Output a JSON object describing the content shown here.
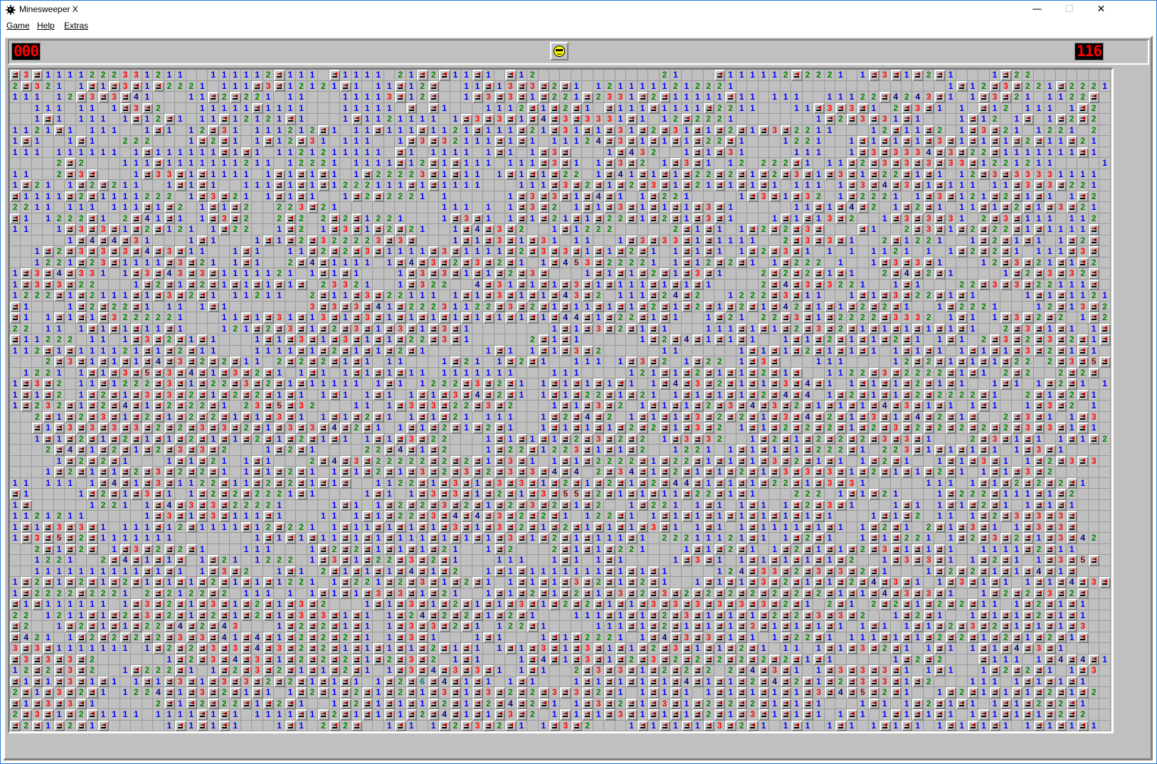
{
  "window": {
    "title": "Minesweeper X",
    "app_icon": "mine-icon",
    "controls": {
      "minimize": "—",
      "maximize": "☐",
      "close": "✕"
    }
  },
  "menubar": {
    "items": [
      "Game",
      "Help",
      "Extras"
    ]
  },
  "status": {
    "mines_remaining": "000",
    "timer": "116",
    "face": "sunglasses-smiley-icon"
  },
  "board": {
    "columns": 100,
    "rows": 60,
    "legend": "c = open empty, 1-8 = number, f = flagged mine",
    "cells": [
      "f3f1111222331211..111112f111.f1111.21f2f11f1.f12...........21...f111112f2221.1f3f1f2f1...1f22......",
      "2f321.1f1f3f1f2221.111f3f12121f1.11f12f..11f13f3f2f1.1211111212221...................1f12f3f221f2221",
      "111.12f3f3f41...11f2f221.11...11113f12f..1f3f3f1f221f2331f2f11111f11.111..11122f4243f1.1f3f21.1122f",
      "..111.11.1f3f2...11111f1111...11111.f.f1...1112f1f2f1.f111f1111f2211...11f3f3f1.2f3f1.1.f12.111.1f2",
      "..1f1.111.1f12f1.11f12121f1...1f1121111.1f3f3f1f4f3f3331f1.12f2221.......1f2f3f31f1...1f12.1f.1f2f2",
      "1121f1.111..1f1.12f31.111212f1.11f111f1121f111f21f31f1f31f2f31f1f2f1f3f2211...12f11f2.1f3f21.1221.2",
      "1f1..1f1..222...1f2f1.1f12f31.111..1f3f32111f1f1.11124f3f1f1f1f22f1...1221..1f1f1f1f3f1f1f1f2f11f21",
      "111.111111.1f111111f1f1.1121211111.f1.1111.1f1.1f3f...1f432..1f1f31....111..1f3f3334f3f22f1111111f1",
      "....2f2...111f1111111211.12221.1111f12f1f111.111f3f1.1f3f2.1f3f1.12.222f1.11f2f3f3f3f33f1221211....1",
      "11..2f3f...1f33f1f1111.1f1f1f1.1f22223f1f11.1f1f1f22.1f41f1f1f22f2f1f2f3f1f3f1f22f1f1.12f3f33331111",
      "1f21.1f2f211..1f1f1..111f1f1f1222111f1f1111...111f3f2f1f2f3f1f21f1f1f1.111.1f3f4f3f1f111.11f3f3f221",
      "f1111f2f1111222.1f3f21.1f1f1..1f2f2221.1.....1f3f3f1f4f1.1f221....1f3f1f32.1f2221.1f3f121f2f1f1.1f2",
      "2211.111.111f1f2.1f1f2..223f21.........111.1.1f3f2.1f1f3f1f1f1f3f1.....11f1f4f2.1f2f1.11f1f2f1f3f21",
      "f1.1222f1.2f41f1.1f3f2..2f2.2f2f1221...1f3f1.1f1f21f1f22f1f2f1f3f1...1f1f13f2..1f3f3f31.2f3f111.112",
      "11..1f3f3f1f2f121.1f22..1f2.1f3f1f2f21..1f4f3f2..1f1222.....2f1f1.1f2f2f3f...f1..2f3f1f2f22f1f1111f",
      ".....1f4f4f31...1f1...1f1f2f322223f3f...1f1f3f1f31.11..1f3f33f1f1111..2f3f3f1..2f1221..1f2f1f1.1f2f",
      "..1f2f3f3f3f4f3f11..1f1..11f2f2f3f1111f3f1111f2f3f3f1f1f2f1.1f1f1.1f2f3f1.1.1.1121.1.1f2f2f1.111f3f",
      "..1221f23f1111f3f21.1f1..2f4f1111.1f4f3f2f3f2f1.1f453f22221.1f12f2f1.1f222.1..1f3f3f1...12f3f21f1f2",
      "1f3f4f331.1f3f43f3f1111121.1f1f1...1f3f3f1f1f2f3f...1f1f1f2f1f3f1...2f2f2f1f1..2f4f2f1....1f2f3f32f",
      "1f3f3f22...1f2f1f2f1f1f1f1f.23321..1f322..4f31f1f1f3f1f111f1f1f1....2f4f3f3221..1f1...22f3f3f22111f",
      "1222f1f2111f1f3f2f1.11211..2f11f3f22111.1f1f3f1f1f43f2.111f24f2..1222f3f11..1f1f3f22f1f1....1f1f1121",
      "f1...1f2f22f1.11.1f1.......3f3f3f41f22231122f3f2f1f11f1f1f2f1f2f1f2f1f42f1f1f2f2f1..1f2221...12f13f2",
      "f1.1f1f1f3222221...11f1f31f13f1f3f1f1f1f1f1f1f1f1f44f1f22f1f1..1f21.22f3f1f2222f3332.1f1.1f3f2f2.1f2",
      "22.11.1f1f1f11f1...121f2f3f1f2f3f1f3f1f3f1.......1f1f3f2f1f1...111f1f1f2f3f2f1f1f1f1f1f1..2f3f1f1.1f",
      "f11222.11.1f3f2f1f1...1f1f3f1f3f1f1f22f3f1.....2f1f1.....1f2f4f1f1f1..1f1f2f1f1f2f1.1f1.2f3f2f3f2f1f",
      "112f1f111121f1f2f11...1111f1f2f1f1f2f1.....1f1.1f1f3f2.....11.....1f1f1f2f1f1f1.1f1f1.1f1f1f3f2f1f1.",
      "...2f3f1f1f1f4f3f2f2f11.2f2f2f1f1.11...1f21.1f2f1..111.1f3f2.1f22.1f3f...111....12f2f1f1f1f22.2f3f5f3",
      ".1221.1f1f3f5f3f4f1f3f2f1.1f1.1f1f1f11.1111111...111....121f1f2f1f1f2f1f..1122f3f2222f1f1.2f2..2f2f",
      "1f3f2.11f1222f3f1f22f3f2f1f11111.1f1.1222f3f2f1.1f1f1f1f1.1f4f3f2f1f1f3f4f1.1f1f1f2f1f1..1f1.1f2f1.1",
      "1f1f2.1f2f1f3f3f2f1f2f2f1f1.1f1.1f1.1f1f3f4f2f1.1f1f22f1f21.1f1f1f1f2f4f4.1f2f1f1f2f2222f1..2f1f2f1",
      "1f232f1f2f4f1f2f22f1.23f5f32...11.1f3f3f22f3f2...1f1f3f2.1f1f1f2f3f4f3f2f1f1f1f4f3f1f1.1f1..1f3f2.1",
      "..2f1f2f3f1f2f1f2f2f1f1f3f1.1f1f2f1.1f1f21.111..1f2f4f2.1f1f1f3f2f2f1f3f4f2f1f3f1f4f2f1f..2f3f1.1f3",
      "..f1f3f3f3f3f2f2f3f3f2f1f3f3f4f2f1.1f1f2f1f2f1..1f1f1f1f2f2f1f3f2.1f1f2f2f2f1f2f3f2f2f2f2f2f3f3f1f1",
      "..1f1f2f1f2f1f1f2f1f1f2f1f2f1f1.1f1f3f22...1f1f1f1f2f3f2f2.1f3f32..1f2f1f2f2f2f3f3f1...2f3f1f1.1f1f2",
      "...2f4f1f2f1f2f3f3f2...1f2f1....22f4f1f2...1f22f1223f1f1f2..1221.1f1f1f1f222f1.223f1f1f1f1.1f3f1..",
      "....1f2f2f1...1f1f21.1f1...2f4f3f22222f2f2f1f3f1.1f1f2222f1f22f1f1f1f3f2f1f1.1f2f1..1f1f3f1.1f2f3f3",
      "...1f2f1f1f2f3f2f2f1.1f1f2f1.1f1f2f1f3f2f3f2f3f3f4f4.2f34f1f2f1f1f2f1f3f3f3f1f2f1f1f2f1.1f1f3f2...",
      "11.111.1f4f1f3f1122f11f2f2f1f1f..1122f1f3f1f3f3f1f2f1f2f1f2f44f1f1f1f22f1f3f31.....111.1f1f2f2f2f1",
      "f1....1f2f1f3f1.1f2f2f2221f1....1f1.1f3f3f1f2f1f3f55f2f1f1f11f22f1f1...222.1f1f21...1f222f111f1f2",
      "1f.....1221.1f4f3f3f22221....1f1.1f2f2f3f2f1f2f3f2f1f2..1f221.1f1.1f1.1f2f3f1...1f1.1f1f2f1.1f1f1",
      "1121211.....1f3f1f3f111f1...11.1f1f22f3f4f4f3f2f2f1.122f1.1f1f1f1f1f1f1f1f1...1f1f2.11.1f2f3f3f3f",
      "1f1f3f3f1.111f12f1111f12f221.1f11f1f1f1f3f1f3f2f1f2f1f1f1f3f1.1f1.1f1111f1f1.1f2f1.2f1f3f1.1f3f3f",
      "1f3f5f2f1111111.......1f1f1f11f1f1f111f1f1f1f3f1f2f1f111f1.22211121f1.1f2f1..1f1f221.1f2f3f2f1f3f42",
      "..2f1f2f.1f3f2f2f1...111...1f2f2f1f1f1f21..1f2...2f1f1f221...1f1f2f1.1f2f1f1f2f3f1f1f1..1111f2f11",
      "..1221..2f4f1f1f.1f21.1222.1f3f1f22f3f2f1...111..1f1.1f1....1f3f1.1f1f1f1f1f2..1f3f3f1.1f2f1.1f3f5f",
      "..1111111111f1f1.1f3f2..1f1.2f1f1f1f4f1f2..1f1f1111111f1f1f1....124f33f2f3f3f2f1...1f2f2f1f1f4f1f",
      "1f2f1f2f1f2f1f1f1f2f1f1f1221.1f221f2f3f1f2f1.1f1f1f3f2f1f2f1..1f1f1f3f2f1f1f2f4f3f1.1f3f1f1.1f1f4f3f",
      "1f2222f2221.2f2122f2.111.1.1f1f1f3f3f1f21..1f1f2f1f2f1f3f2f3f2f2f2f2f2f2f2f1f1f4f3f3f1..1f2f2f3f2f",
      "f1f111111.1f3f2f1f3f1f2f1f3f2...1f1f3f1f2f1f1f3f1f2f2f1f1f3f3f3f3f3f3f2f1.2f1.2f2f1f2f2f11.1f2f1f1",
      "22.1211f1f2f3f2f1f2f1f2f1f3f3f1f1.1f24f2f2f1f2f1...111f1f1f2f3f1f1f1f2f2f3f3f2..1f2f1..1f1f1f2f1f1",
      "f2..1f2f1f1f22f4f2f43...1f2f2f1f1.1f3f3f2f1.122f1....111f1f2f1f1f1f3f1f1f1f1.1f1.1f1f2f3f2f1f1f1f3",
      "f421.1f2f2f2f2f3f3f41f4f1f2f2f2f1.1f3f1...1f1...1f1f2221.1f4f3f3f1f1.1f22f1.111f1f1f2f2f1f2f1f2f1f",
      "3f3f1111111.1f2f2f3f3f4f3f2f2f1f1f1f1f2f1f1.1f1f3f1f3f1f1f2f3f1f1f2f1.11.1f1f3f2f1.1f1.1f1f4f3f1",
      "f3f3f3f2......1f2f3f4f3f1f2f2f2f1f2f3f2.1f1...1f4f1f3f1f2f3f2f2f2f2f2f2f1f1.....1f2f2...f111.1f4f4f1",
      "12f2f3f2..1f222f1.1f2f3f2f1f1f2f1.1f3f4f3f3f1.1f1..2f3f3f1f2f2f2.2f4f3f1.1f3f3f3f1.1f1..1f2f2f1.1f3",
      "f1f1f3f1f1.1f1f3f1f3f3f2f2f1f1f1.1f2f6f4f1f1.1f1...1f1f1f1f1f4f1f1f2f4f2f1f2f3f3f1f2...111.1f1f1f1",
      "2f1f3f2f1.1224f1f3f2f1f1.1f2f1f2f1f2f1f3f1f3f2f2f3f3f2f1.1f1f1.1f1f1f1f1f3f4f5f2f1..1f2f1f1f1f2f1f2",
      "f1f3f3f1.....2f1f2f22f1f2f1..1f2f1f1f1f2f1f2f4f2f1.1f3f2f1f3f1f2f2f2f1f1f1...1f1.1f2f1f1.1f1f2f2f1",
      "2f3f1f2f1111.1111f1f1.1111f1f2f1f1f1f2f4f1f1f3f2.1f1f1f3f1f1f1f2f1f3f1f1f1.1f1.1f1f1f1.1f1f1f1f2f2",
      "f2f1f2f1f.....1f1f1f1...1f1.2f2f..1f1.1f2f3f2f1.1f3f2...1f1f1f1f3f2f1.1f1.1f1.1f1f1.1f1f1f1.1f1f1f1"
    ]
  }
}
